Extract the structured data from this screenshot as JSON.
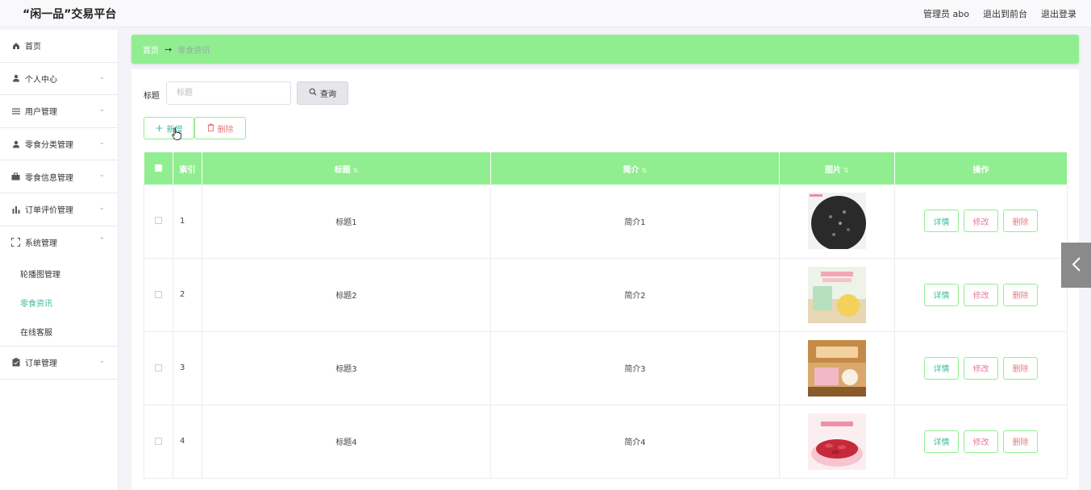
{
  "header": {
    "site_title": "“闲一品”交易平台",
    "admin_label": "管理员 abo",
    "back_front": "退出到前台",
    "logout": "退出登录"
  },
  "sidebar": {
    "items": [
      {
        "label": "首页",
        "icon": "home-icon"
      },
      {
        "label": "个人中心",
        "icon": "user-icon"
      },
      {
        "label": "用户管理",
        "icon": "list-icon"
      },
      {
        "label": "零食分类管理",
        "icon": "user-icon"
      },
      {
        "label": "零食信息管理",
        "icon": "briefcase-icon"
      },
      {
        "label": "订单评价管理",
        "icon": "bar-chart-icon"
      },
      {
        "label": "系统管理",
        "icon": "fullscreen-icon"
      }
    ],
    "system_sub": [
      {
        "label": "轮播图管理"
      },
      {
        "label": "零食资讯"
      },
      {
        "label": "在线客服"
      }
    ],
    "order_item": {
      "label": "订单管理",
      "icon": "clipboard-icon"
    }
  },
  "breadcrumb": {
    "home": "首页",
    "current": "零食资讯"
  },
  "search": {
    "label": "标题",
    "placeholder": "标题",
    "button": "查询"
  },
  "actions": {
    "add": "新增",
    "delete": "删除"
  },
  "table": {
    "headers": {
      "index": "索引",
      "title": "标题",
      "intro": "简介",
      "image": "图片",
      "ops": "操作"
    },
    "rows": [
      {
        "index": "1",
        "title": "标题1",
        "intro": "简介1"
      },
      {
        "index": "2",
        "title": "标题2",
        "intro": "简介2"
      },
      {
        "index": "3",
        "title": "标题3",
        "intro": "简介3"
      },
      {
        "index": "4",
        "title": "标题4",
        "intro": "简介4"
      }
    ],
    "op_labels": {
      "detail": "详情",
      "edit": "修改",
      "remove": "删除"
    }
  },
  "colors": {
    "accent": "#90ee90",
    "active": "#3fbaa0"
  }
}
